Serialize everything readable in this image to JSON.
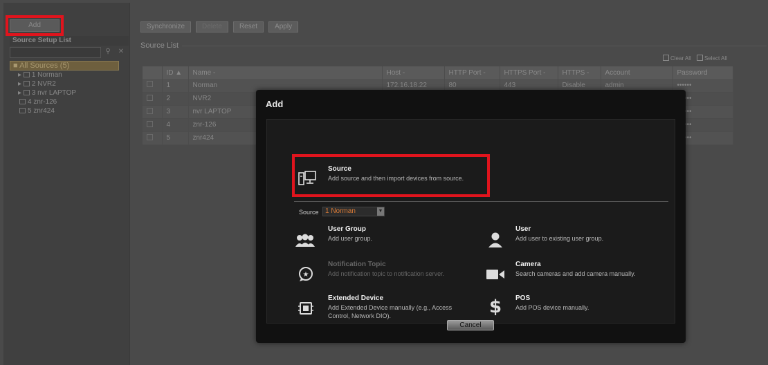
{
  "toolbar": {
    "add": "Add",
    "buttons": [
      "Synchronize",
      "Delete",
      "Reset",
      "Apply"
    ]
  },
  "left_panel": {
    "title": "Source Setup List",
    "root": "All Sources (5)",
    "items": [
      "1 Norman",
      "2 NVR2",
      "3 nvr LAPTOP",
      "4 znr-126",
      "5 znr424"
    ]
  },
  "source_list": {
    "label": "Source List",
    "clear_all": "Clear All",
    "select_all": "Select All",
    "columns": [
      "ID",
      "Name",
      "Host",
      "HTTP Port",
      "HTTPS Port",
      "HTTPS",
      "Account",
      "Password"
    ],
    "rows": [
      {
        "id": "1",
        "name": "Norman",
        "host": "172.16.18.22",
        "http": "80",
        "https_port": "443",
        "https": "Disable",
        "account": "admin",
        "password": "••••••"
      },
      {
        "id": "2",
        "name": "NVR2",
        "host": "",
        "http": "",
        "https_port": "",
        "https": "",
        "account": "",
        "password": "••••••"
      },
      {
        "id": "3",
        "name": "nvr LAPTOP",
        "host": "",
        "http": "",
        "https_port": "",
        "https": "",
        "account": "",
        "password": "••••••"
      },
      {
        "id": "4",
        "name": "znr-126",
        "host": "",
        "http": "",
        "https_port": "",
        "https": "",
        "account": "",
        "password": "••••••"
      },
      {
        "id": "5",
        "name": "znr424",
        "host": "",
        "http": "",
        "https_port": "",
        "https": "",
        "account": "",
        "password": "••••••"
      }
    ]
  },
  "modal": {
    "title": "Add",
    "source_option": {
      "title": "Source",
      "desc": "Add source and then import devices from source."
    },
    "source_select_label": "Source",
    "source_select_value": "1 Norman",
    "options": {
      "user_group": {
        "title": "User Group",
        "desc": "Add user group."
      },
      "user": {
        "title": "User",
        "desc": "Add user to existing user group."
      },
      "notification": {
        "title": "Notification Topic",
        "desc": "Add notification topic to notification server."
      },
      "camera": {
        "title": "Camera",
        "desc": "Search cameras and add camera manually."
      },
      "extended": {
        "title": "Extended Device",
        "desc": "Add Extended Device manually (e.g., Access Control, Network DIO)."
      },
      "pos": {
        "title": "POS",
        "desc": "Add POS device manually."
      }
    },
    "cancel": "Cancel"
  },
  "colors": {
    "highlight": "#e0141d",
    "select_text": "#d87a36"
  }
}
